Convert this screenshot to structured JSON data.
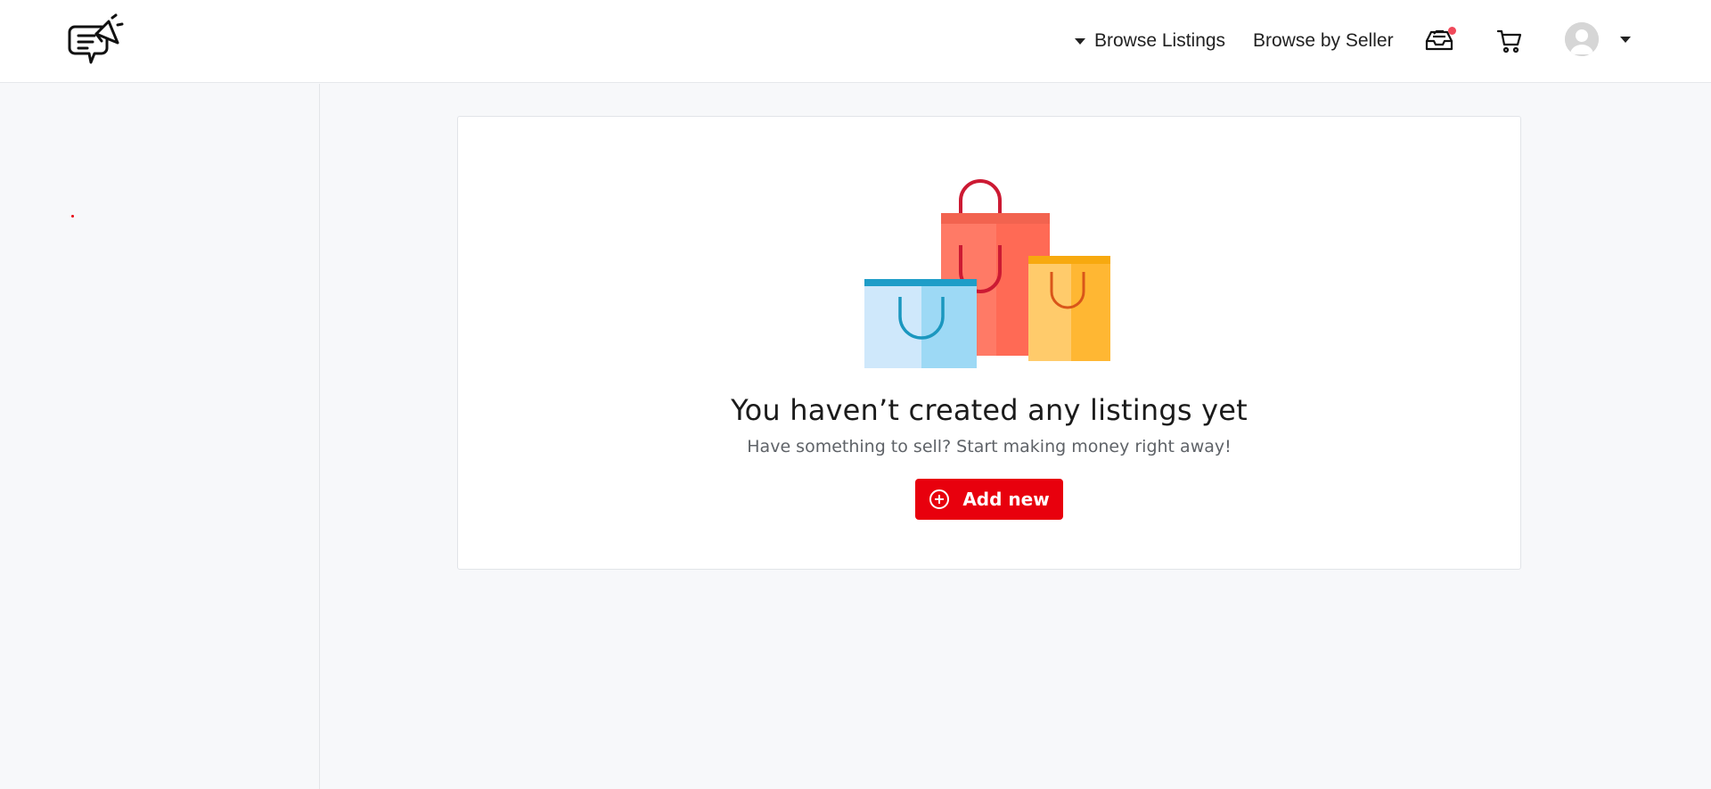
{
  "header": {
    "nav": {
      "browse_listings": "Browse Listings",
      "browse_by_seller": "Browse by Seller"
    },
    "icons": {
      "logo": "chat-megaphone-logo",
      "inbox": "inbox-icon",
      "cart": "cart-icon",
      "avatar": "user-avatar",
      "notification_color": "#f0495a"
    }
  },
  "empty_state": {
    "title": "You haven’t created any listings yet",
    "subtitle": "Have something to sell? Start making money right away!",
    "button_label": "Add new",
    "button_icon": "plus-circle-icon",
    "illustration": "shopping-bags-illustration"
  },
  "colors": {
    "accent": "#e8000d",
    "background": "#f7f8fa",
    "card": "#ffffff"
  }
}
